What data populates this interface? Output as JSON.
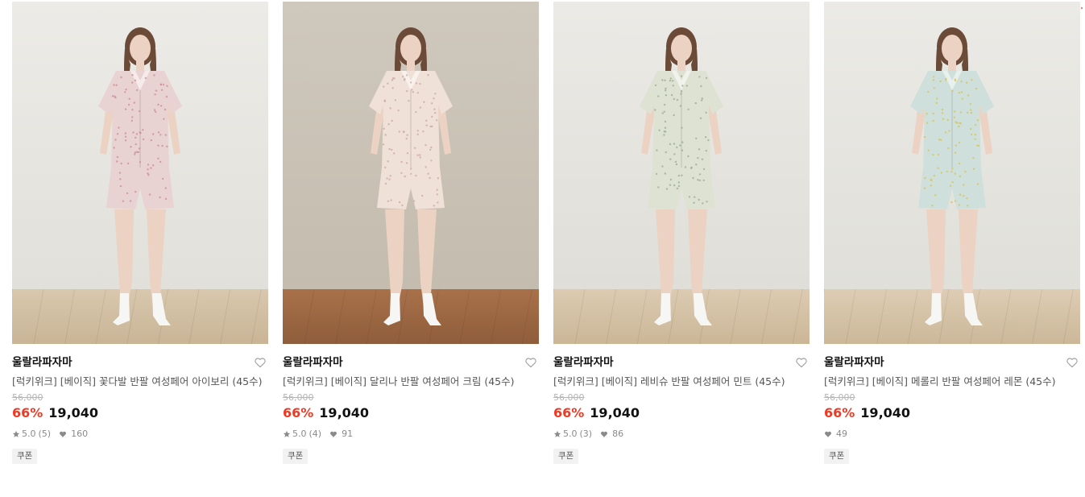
{
  "colors": {
    "discount": "#ee3a24",
    "price": "#111111",
    "original_price": "#b5b5b5"
  },
  "products": [
    {
      "brand": "울랄라파자마",
      "name": "[럭키위크] [베이직] 꽃다발 반팔 여성페어 아이보리 (45수)",
      "original_price": "56,000",
      "discount": "66%",
      "price": "19,040",
      "rating": "5.0",
      "review_count": "(5)",
      "likes": "160",
      "badge": "쿠폰",
      "image_desc": "model in pink floral short-sleeve pajama set",
      "wall_top": "#ecebe7",
      "wall_bot": "#e2e0da",
      "floor_top": "#d9c8ae",
      "floor_bot": "#c9b495",
      "garment": "#e9d2d2",
      "dots": "#c98a94"
    },
    {
      "brand": "울랄라파자마",
      "name": "[럭키위크] [베이직] 달리나 반팔 여성페어 크림 (45수)",
      "original_price": "56,000",
      "discount": "66%",
      "price": "19,040",
      "rating": "5.0",
      "review_count": "(4)",
      "likes": "91",
      "badge": "쿠폰",
      "image_desc": "model in cream floral short-sleeve pajama set",
      "wall_top": "#cfc8bd",
      "wall_bot": "#c4bcae",
      "floor_top": "#a8714a",
      "floor_bot": "#8f5d3b",
      "garment": "#efe0d8",
      "dots": "#c9a7a0"
    },
    {
      "brand": "울랄라파자마",
      "name": "[럭키위크] [베이직] 레비슈 반팔 여성페어 민트 (45수)",
      "original_price": "56,000",
      "discount": "66%",
      "price": "19,040",
      "rating": "5.0",
      "review_count": "(3)",
      "likes": "86",
      "badge": "쿠폰",
      "image_desc": "model in mint floral short-sleeve pajama set",
      "wall_top": "#eceae6",
      "wall_bot": "#e0ded8",
      "floor_top": "#dccbb2",
      "floor_bot": "#cbb696",
      "garment": "#dde2d3",
      "dots": "#9aa88c"
    },
    {
      "brand": "울랄라파자마",
      "name": "[럭키위크] [베이직] 메롤리 반팔 여성페어 레몬 (45수)",
      "original_price": "56,000",
      "discount": "66%",
      "price": "19,040",
      "rating": "",
      "review_count": "",
      "likes": "49",
      "badge": "쿠폰",
      "image_desc": "model in lemon-blue floral short-sleeve pajama set",
      "wall_top": "#ebeae6",
      "wall_bot": "#e0dfd9",
      "floor_top": "#ddcdb4",
      "floor_bot": "#ccb798",
      "garment": "#cfe0dc",
      "dots": "#d9c24a"
    }
  ]
}
